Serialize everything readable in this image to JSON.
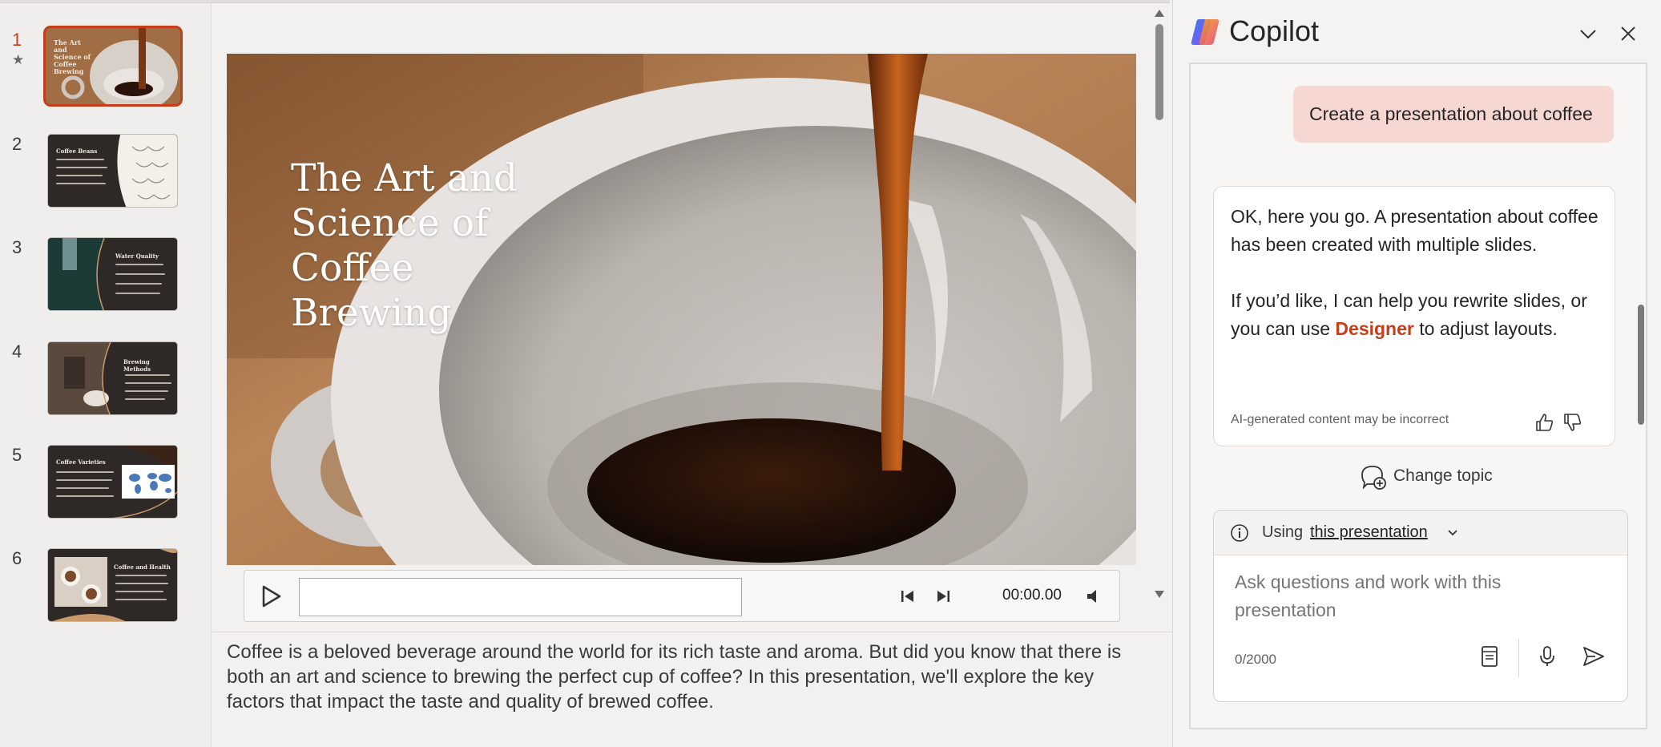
{
  "slides_panel": {
    "slides": [
      {
        "number": "1",
        "title": "The Art and Science of Coffee Brewing",
        "starred": true
      },
      {
        "number": "2",
        "title": "Coffee Beans"
      },
      {
        "number": "3",
        "title": "Water Quality"
      },
      {
        "number": "4",
        "title": "Brewing Methods"
      },
      {
        "number": "5",
        "title": "Coffee Varieties"
      },
      {
        "number": "6",
        "title": "Coffee and Health"
      }
    ]
  },
  "slide": {
    "title": "The Art and Science of Coffee Brewing"
  },
  "media": {
    "time": "00:00.00"
  },
  "notes": {
    "text": "Coffee is a beloved beverage around the world for its rich taste and aroma. But did you know that there is both an art and science to brewing the perfect cup of coffee? In this presentation, we'll explore the key factors that impact the taste and quality of brewed coffee."
  },
  "copilot": {
    "title": "Copilot",
    "user_message": "Create a presentation about coffee",
    "ai_message": {
      "para1": "OK, here you go. A presentation about coffee has been created with multiple slides.",
      "para2_before": "If you’d like, I can help you rewrite slides, or you can use ",
      "para2_link": "Designer",
      "para2_after": " to adjust layouts.",
      "disclaimer": "AI-generated content may be incorrect"
    },
    "change_topic": "Change topic",
    "context": {
      "using_label": "Using",
      "link": "this presentation"
    },
    "input": {
      "placeholder": "Ask questions and work with this presentation",
      "counter": "0/2000"
    }
  },
  "colors": {
    "accent": "#c43e1c",
    "user_bubble": "#f7d7d1"
  }
}
